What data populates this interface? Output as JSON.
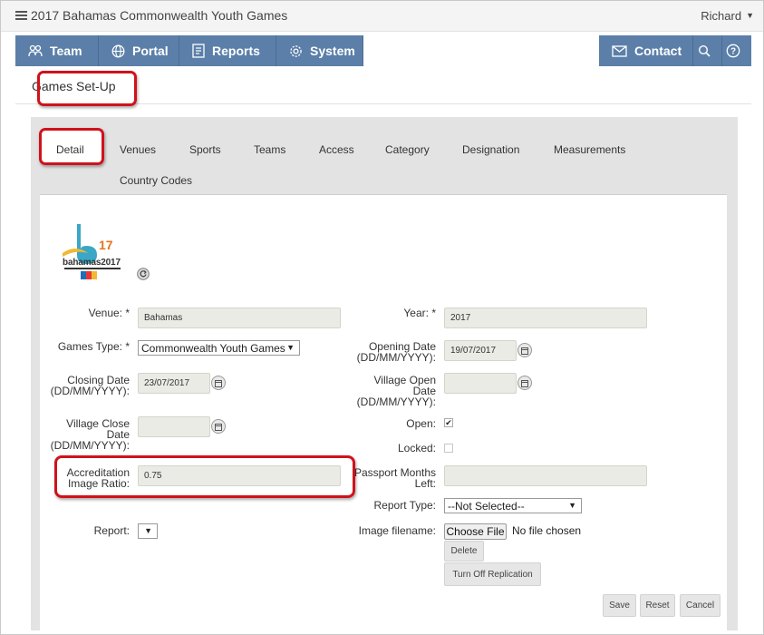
{
  "app": {
    "title": "2017 Bahamas Commonwealth Youth Games",
    "user": "Richard"
  },
  "nav": {
    "team": "Team",
    "portal": "Portal",
    "reports": "Reports",
    "system": "System",
    "contact": "Contact",
    "icons": {
      "team": "team-icon",
      "portal": "globe-icon",
      "reports": "reports-icon",
      "system": "gear-icon",
      "contact": "envelope-icon",
      "search": "search-icon",
      "help": "help-icon"
    }
  },
  "page": {
    "title": "Games Set-Up"
  },
  "tabs": [
    "Detail",
    "Venues",
    "Sports",
    "Teams",
    "Access",
    "Category",
    "Designation",
    "Measurements",
    "Country Codes"
  ],
  "logo": {
    "text": "bahamas2017",
    "number": "17"
  },
  "form": {
    "venue": {
      "label": "Venue: *",
      "value": "Bahamas"
    },
    "year": {
      "label": "Year: *",
      "value": "2017"
    },
    "games_type": {
      "label": "Games Type: *",
      "value": "Commonwealth Youth Games"
    },
    "opening_date": {
      "label_1": "Opening Date",
      "label_2": "(DD/MM/YYYY):",
      "value": "19/07/2017"
    },
    "closing_date": {
      "label_1": "Closing Date",
      "label_2": "(DD/MM/YYYY):",
      "value": "23/07/2017"
    },
    "village_open_date": {
      "label_1": "Village Open",
      "label_2": "Date",
      "label_3": "(DD/MM/YYYY):",
      "value": ""
    },
    "village_close_date": {
      "label_1": "Village Close",
      "label_2": "Date",
      "label_3": "(DD/MM/YYYY):",
      "value": ""
    },
    "open": {
      "label": "Open:",
      "checked": true,
      "mark": "✔"
    },
    "locked": {
      "label": "Locked:",
      "checked": false
    },
    "accreditation_ratio": {
      "label_1": "Accreditation",
      "label_2": "Image Ratio:",
      "value": "0.75"
    },
    "passport_months": {
      "label_1": "Passport Months",
      "label_2": "Left:",
      "value": ""
    },
    "report_type": {
      "label": "Report Type:",
      "value": "--Not Selected--"
    },
    "report": {
      "label": "Report:",
      "value": ""
    },
    "image_filename": {
      "label": "Image filename:",
      "button": "Choose File",
      "status": "No file chosen"
    }
  },
  "buttons": {
    "delete": "Delete",
    "replication": "Turn Off Replication",
    "save": "Save",
    "reset": "Reset",
    "cancel": "Cancel"
  },
  "colors": {
    "nav": "#5b7fa8",
    "highlight": "#d0121b"
  }
}
